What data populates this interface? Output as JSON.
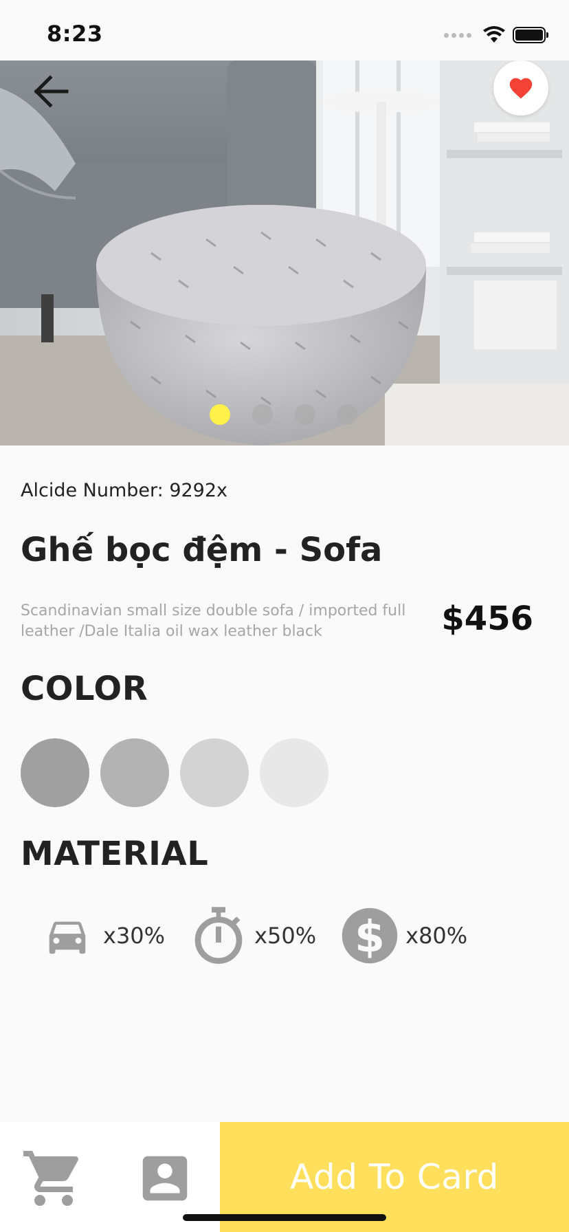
{
  "status_bar": {
    "time": "8:23"
  },
  "hero": {
    "image_alt": "Tufted gray ottoman next to a gray sofa",
    "slides_total": 4,
    "active_slide": 1
  },
  "product": {
    "article_number": "Alcide Number: 9292x",
    "title": "Ghế bọc đệm - Sofa",
    "description": "Scandinavian small size double sofa / imported full leather /Dale Italia oil wax leather black",
    "price": "$456"
  },
  "color": {
    "heading": "COLOR",
    "swatches": [
      "#a0a0a0",
      "#b3b3b3",
      "#d3d3d3",
      "#e8e8e8"
    ]
  },
  "material": {
    "heading": "MATERIAL",
    "items": [
      {
        "icon": "car-icon",
        "value": "x30%"
      },
      {
        "icon": "timer-icon",
        "value": "x50%"
      },
      {
        "icon": "dollar-icon",
        "value": "x80%"
      }
    ]
  },
  "bottom_bar": {
    "add_button_label": "Add To Card"
  },
  "colors": {
    "accent": "#ffdf5c",
    "active_dot": "#fff04a",
    "heart": "#f44336",
    "icon_gray": "#9e9e9e"
  }
}
